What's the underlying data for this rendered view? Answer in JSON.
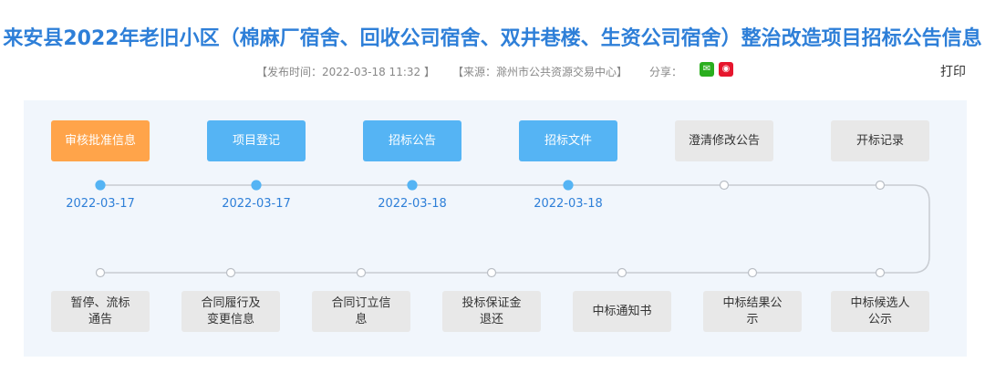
{
  "header": {
    "title": "来安县2022年老旧小区（棉麻厂宿舍、回收公司宿舍、双井巷楼、生资公司宿舍）整治改造项目招标公告信息",
    "publish": "【发布时间：2022-03-18 11:32 】",
    "source": "【来源：滁州市公共资源交易中心】",
    "share_label": "分享：",
    "print_label": "打印"
  },
  "colors": {
    "title": "#2e7fd8",
    "current": "#ffa44a",
    "done": "#55b4f4",
    "pending": "#e8e8e8"
  },
  "steps_top": [
    {
      "label": "审核批准信息",
      "date": "2022-03-17",
      "state": "current"
    },
    {
      "label": "项目登记",
      "date": "2022-03-17",
      "state": "done"
    },
    {
      "label": "招标公告",
      "date": "2022-03-18",
      "state": "done"
    },
    {
      "label": "招标文件",
      "date": "2022-03-18",
      "state": "done"
    },
    {
      "label": "澄清修改公告",
      "date": "",
      "state": "pending"
    },
    {
      "label": "开标记录",
      "date": "",
      "state": "pending"
    }
  ],
  "steps_bottom": [
    {
      "label": "暂停、流标通告"
    },
    {
      "label": "合同履行及变更信息"
    },
    {
      "label": "合同订立信息"
    },
    {
      "label": "投标保证金退还"
    },
    {
      "label": "中标通知书"
    },
    {
      "label": "中标结果公示"
    },
    {
      "label": "中标候选人公示"
    }
  ]
}
